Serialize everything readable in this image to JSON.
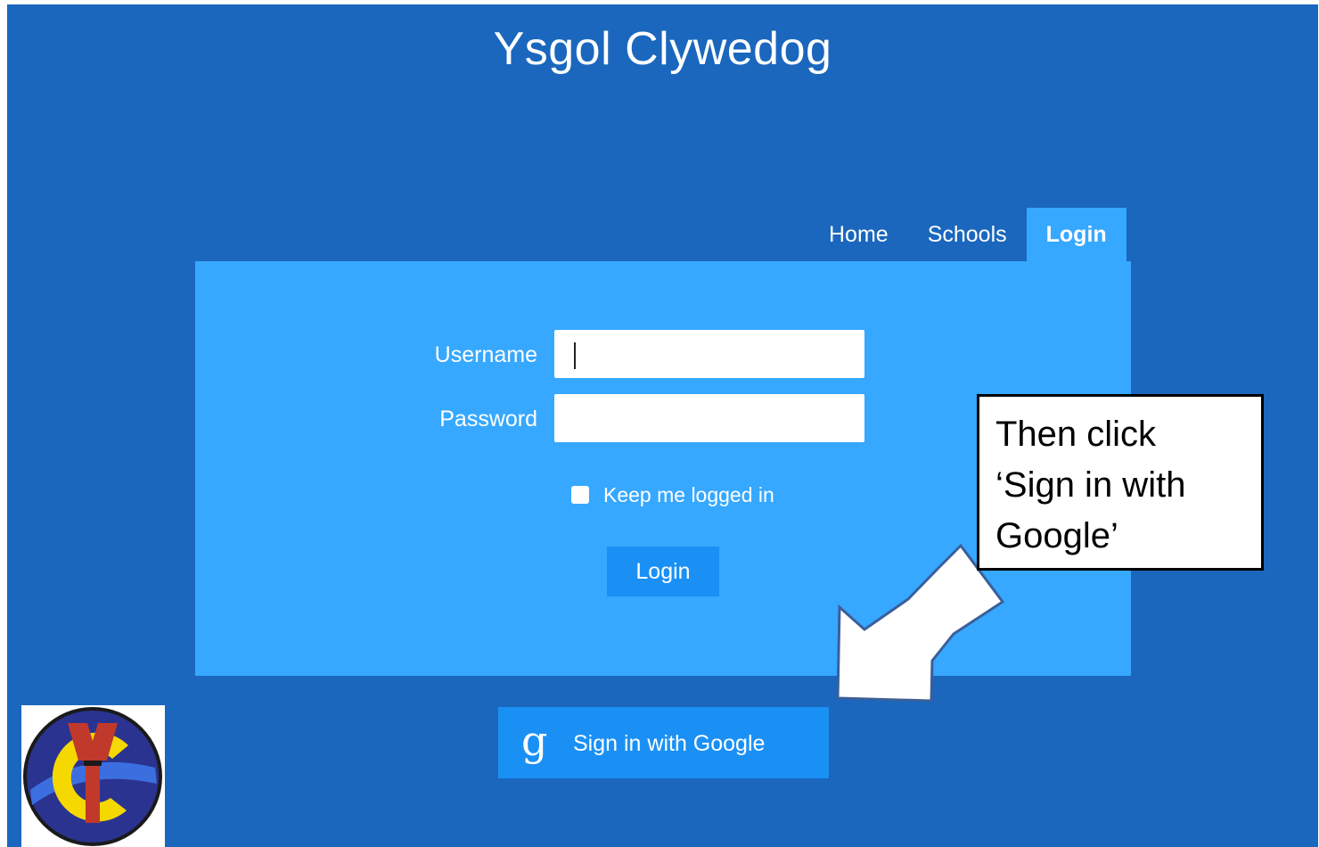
{
  "site": {
    "title": "Ysgol Clywedog"
  },
  "nav": {
    "items": [
      {
        "label": "Home"
      },
      {
        "label": "Schools"
      },
      {
        "label": "Login"
      }
    ],
    "active": "Login"
  },
  "login_form": {
    "username_label": "Username",
    "username_value": "",
    "password_label": "Password",
    "password_value": "",
    "remember_label": "Keep me logged in",
    "remember_checked": false,
    "submit_label": "Login"
  },
  "google_signin": {
    "icon_glyph": "g",
    "label": "Sign in with Google"
  },
  "annotation": {
    "text": "Then click ‘Sign in with Google’"
  },
  "colors": {
    "background": "#1a67bd",
    "panel": "#36a8ff",
    "button": "#1a90f5"
  },
  "icons": {
    "google": "google-g-icon",
    "arrow": "pointer-arrow-icon",
    "logo": "school-crest-logo"
  }
}
